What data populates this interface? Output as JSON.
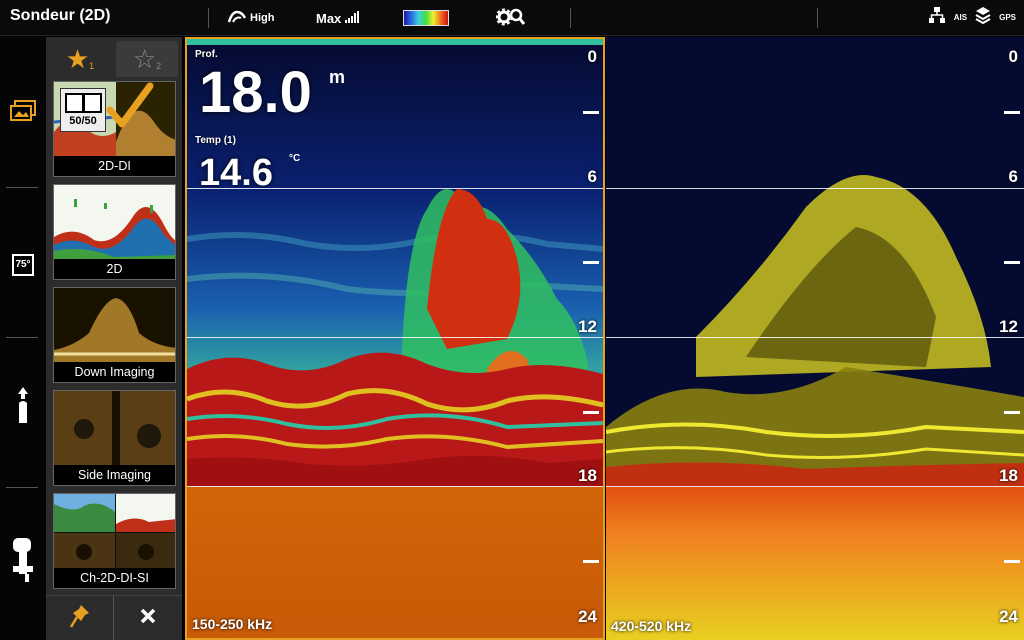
{
  "app": {
    "title": "Sondeur (2D)"
  },
  "topbar": {
    "sensitivity_label": "High",
    "range_label": "Max",
    "palette_colors": [
      "#1a1aa8",
      "#2a6ae0",
      "#3fd0e0",
      "#3fe040",
      "#f0f030",
      "#f07020",
      "#d01010"
    ],
    "status": {
      "ais_label": "AIS",
      "gps_label": "GPS"
    }
  },
  "leftnav": {
    "speed_value": "75°"
  },
  "views": {
    "tabs": [
      {
        "label": "★",
        "index": "1",
        "active": true
      },
      {
        "label": "☆",
        "index": "2",
        "active": false
      }
    ],
    "split_label": "50/50",
    "items": [
      {
        "label": "2D-DI",
        "selected": true
      },
      {
        "label": "2D",
        "selected": false
      },
      {
        "label": "Down Imaging",
        "selected": false
      },
      {
        "label": "Side Imaging",
        "selected": false
      },
      {
        "label": "Ch-2D-DI-SI",
        "selected": false
      }
    ]
  },
  "sonar_left": {
    "depth_title": "Prof.",
    "depth_value": "18.0",
    "depth_unit": "m",
    "temp_title": "Temp (1)",
    "temp_value": "14.6",
    "temp_unit": "°C",
    "frequency": "150-250 kHz",
    "scale_labels": [
      "0",
      "6",
      "12",
      "18",
      "24"
    ]
  },
  "sonar_right": {
    "frequency": "420-520 kHz",
    "scale_labels": [
      "0",
      "6",
      "12",
      "18",
      "24"
    ]
  },
  "colors": {
    "accent": "#e8a020",
    "bottom_orange": "#d2640a",
    "water_dark": "#050a30",
    "di_yellow": "#e8e020"
  }
}
